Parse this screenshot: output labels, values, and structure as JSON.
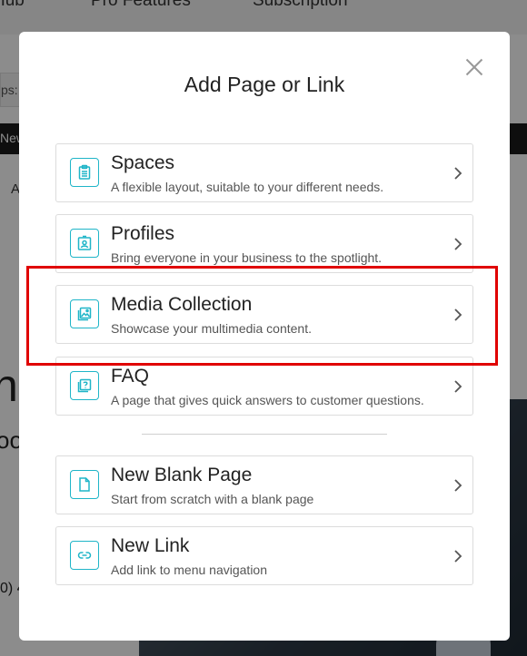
{
  "background": {
    "nav_items": [
      "Hub",
      "Pro Features",
      "Subscription"
    ],
    "url_fragment": "ps:",
    "darkbar_text": "New",
    "letter_a": "A",
    "big_letter": "n",
    "partial_text": "oo",
    "phone_fragment": "0) 4"
  },
  "modal": {
    "title": "Add Page or Link",
    "close_label": "×",
    "options": [
      {
        "title": "Spaces",
        "description": "A flexible layout, suitable to your different needs.",
        "icon": "clipboard-icon"
      },
      {
        "title": "Profiles",
        "description": "Bring everyone in your business to the spotlight.",
        "icon": "profile-badge-icon"
      },
      {
        "title": "Media Collection",
        "description": "Showcase your multimedia content.",
        "icon": "image-gallery-icon"
      },
      {
        "title": "FAQ",
        "description": "A page that gives quick answers to customer questions.",
        "icon": "question-icon"
      },
      {
        "title": "New Blank Page",
        "description": "Start from scratch with a blank page",
        "icon": "blank-page-icon"
      },
      {
        "title": "New Link",
        "description": "Add link to menu navigation",
        "icon": "link-icon"
      }
    ]
  },
  "colors": {
    "accent": "#1fb5c8",
    "highlight": "#e00000"
  }
}
